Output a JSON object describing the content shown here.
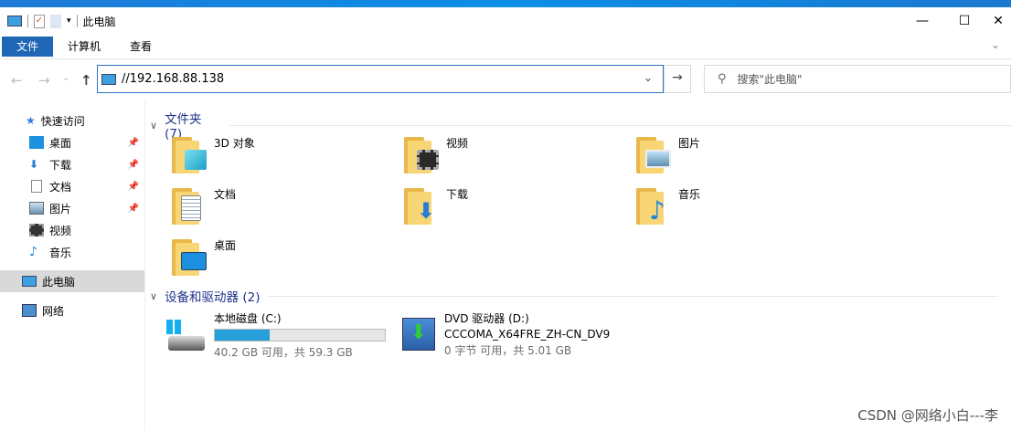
{
  "window": {
    "title": "此电脑",
    "minimize": "—",
    "maximize": "☐",
    "close": "✕"
  },
  "ribbon": {
    "tabs": [
      "文件",
      "计算机",
      "查看"
    ],
    "expand": "⌄"
  },
  "nav": {
    "back": "←",
    "forward": "→",
    "recent": "⌄",
    "up": "↑",
    "address": "//192.168.88.138",
    "address_dropdown": "⌄",
    "go": "→",
    "search_placeholder": "搜索\"此电脑\""
  },
  "sidebar": {
    "quick_access": "快速访问",
    "items": [
      {
        "label": "桌面",
        "pinned": true
      },
      {
        "label": "下载",
        "pinned": true
      },
      {
        "label": "文档",
        "pinned": true
      },
      {
        "label": "图片",
        "pinned": true
      },
      {
        "label": "视频",
        "pinned": false
      },
      {
        "label": "音乐",
        "pinned": false
      }
    ],
    "this_pc": "此电脑",
    "network": "网络"
  },
  "folders_section": {
    "title": "文件夹 (7)",
    "items": [
      "3D 对象",
      "视频",
      "图片",
      "文档",
      "下载",
      "音乐",
      "桌面"
    ]
  },
  "drives_section": {
    "title": "设备和驱动器 (2)",
    "drives": [
      {
        "name": "本地磁盘 (C:)",
        "free": "40.2 GB 可用，共 59.3 GB",
        "used_fraction": 0.32
      },
      {
        "name": "DVD 驱动器 (D:)",
        "label": "CCCOMA_X64FRE_ZH-CN_DV9",
        "free": "0 字节 可用，共 5.01 GB"
      }
    ]
  },
  "watermark": "CSDN @网络小白---李",
  "colors": {
    "accent": "#1f66b5",
    "progress": "#26a0da",
    "section": "#1e3287"
  }
}
